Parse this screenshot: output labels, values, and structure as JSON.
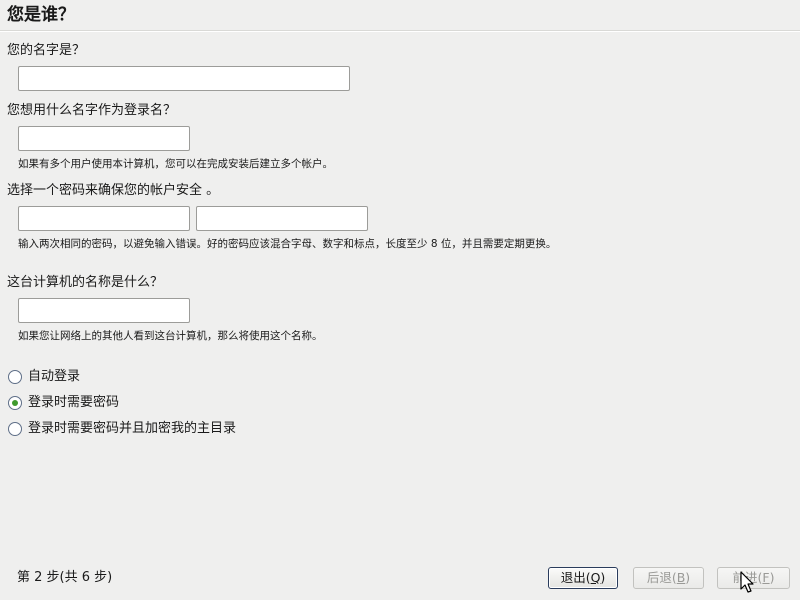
{
  "header": {
    "title": "您是谁？"
  },
  "full_name": {
    "label": "您的名字是？",
    "value": ""
  },
  "username": {
    "label": "您想用什么名字作为登录名？",
    "value": "",
    "hint": "如果有多个用户使用本计算机，您可以在完成安装后建立多个帐户。"
  },
  "password": {
    "label": "选择一个密码来确保您的帐户安全 。",
    "value": "",
    "confirm_value": "",
    "hint": "输入两次相同的密码，以避免输入错误。好的密码应该混合字母、数字和标点，长度至少 8 位，并且需要定期更换。"
  },
  "hostname": {
    "label": "这台计算机的名称是什么？",
    "value": "",
    "hint": "如果您让网络上的其他人看到这台计算机，那么将使用这个名称。"
  },
  "login_options": {
    "selected": "require_password",
    "items": [
      {
        "id": "auto_login",
        "label": "自动登录"
      },
      {
        "id": "require_password",
        "label": "登录时需要密码"
      },
      {
        "id": "encrypt_home",
        "label": "登录时需要密码并且加密我的主目录"
      }
    ]
  },
  "footer": {
    "step_text": "第 2 步(共 6 步)",
    "quit": {
      "label": "退出(",
      "mnemonic": "Q",
      "suffix": ")",
      "enabled": true
    },
    "back": {
      "label": "后退(",
      "mnemonic": "B",
      "suffix": ")",
      "enabled": false
    },
    "forward": {
      "label": "前进(",
      "mnemonic": "F",
      "suffix": ")",
      "enabled": false
    }
  }
}
